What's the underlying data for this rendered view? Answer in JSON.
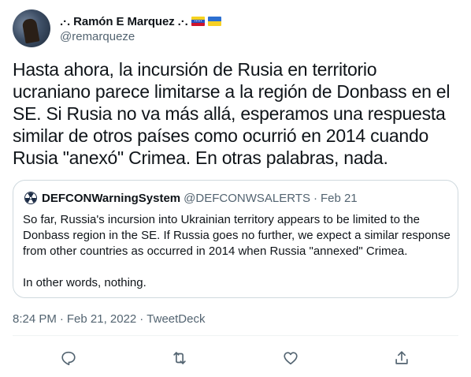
{
  "author": {
    "display_name": ".·. Ramón E Marquez .·.",
    "handle": "@remarqueze",
    "flags": [
      "venezuela-flag-icon",
      "ukraine-flag-icon"
    ]
  },
  "tweet": {
    "text": "Hasta ahora, la incursión de Rusia en territorio ucraniano parece limitarse a la región de Donbass en el SE. Si Rusia no va más allá, esperamos una respuesta similar de otros países como ocurrió en 2014 cuando Rusia \"anexó\" Crimea. En otras palabras, nada."
  },
  "quote": {
    "name": "DEFCONWarningSystem",
    "handle": "@DEFCONWSALERTS",
    "separator": "·",
    "date": "Feb 21",
    "lines": [
      "So far, Russia's incursion into Ukrainian territory appears to be limited to the",
      "Donbass region in the SE. If Russia goes no further, we expect a similar response",
      "from other countries as occurred in 2014 when Russia \"annexed\" Crimea."
    ],
    "last_line": "In other words, nothing."
  },
  "meta": {
    "time": "8:24 PM",
    "separator": "·",
    "date": "Feb 21, 2022",
    "source": "TweetDeck"
  },
  "actions": [
    "reply-icon",
    "retweet-icon",
    "like-icon",
    "share-icon"
  ],
  "colors": {
    "text": "#0f1419",
    "secondary": "#536471",
    "border": "#cfd9de"
  }
}
